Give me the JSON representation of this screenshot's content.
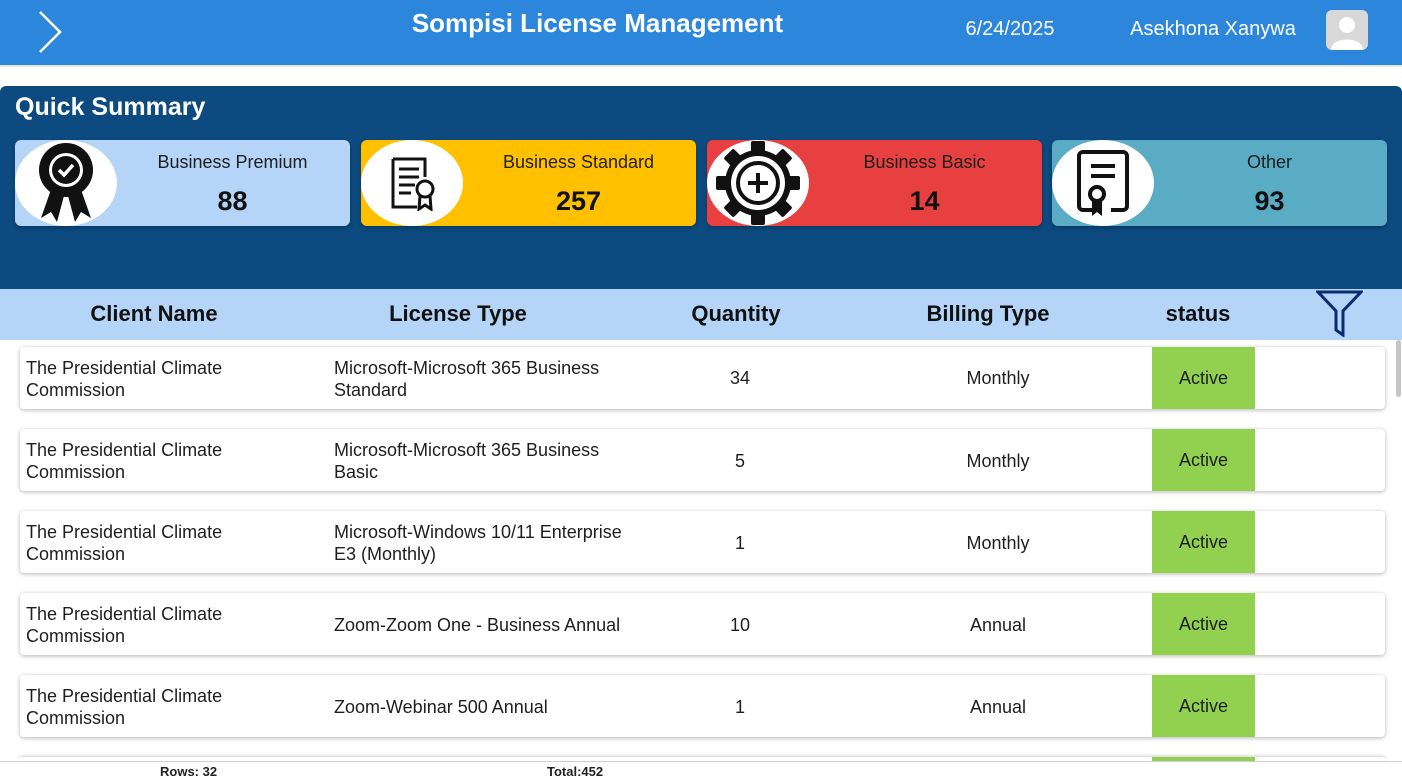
{
  "header": {
    "title": "Sompisi License Management",
    "date": "6/24/2025",
    "user_name": "Asekhona Xanywa"
  },
  "summary": {
    "title": "Quick Summary",
    "cards": [
      {
        "label": "Business Premium",
        "value": "88",
        "icon": "award-ribbon-icon",
        "color": "#b4d4f8"
      },
      {
        "label": "Business Standard",
        "value": "257",
        "icon": "certificate-document-icon",
        "color": "#ffc000"
      },
      {
        "label": "Business Basic",
        "value": "14",
        "icon": "gear-plus-icon",
        "color": "#e84040"
      },
      {
        "label": "Other",
        "value": "93",
        "icon": "license-document-icon",
        "color": "#5aacc4"
      }
    ]
  },
  "table": {
    "columns": [
      "Client Name",
      "License Type",
      "Quantity",
      "Billing Type",
      "status"
    ],
    "rows": [
      {
        "client": "The Presidential Climate Commission",
        "license": "Microsoft-Microsoft 365 Business Standard",
        "quantity": "34",
        "billing": "Monthly",
        "status": "Active"
      },
      {
        "client": "The Presidential Climate Commission",
        "license": "Microsoft-Microsoft 365 Business Basic",
        "quantity": "5",
        "billing": "Monthly",
        "status": "Active"
      },
      {
        "client": "The Presidential Climate Commission",
        "license": "Microsoft-Windows 10/11 Enterprise E3 (Monthly)",
        "quantity": "1",
        "billing": "Monthly",
        "status": "Active"
      },
      {
        "client": "The Presidential Climate Commission",
        "license": "Zoom-Zoom One - Business Annual",
        "quantity": "10",
        "billing": "Annual",
        "status": "Active"
      },
      {
        "client": "The Presidential Climate Commission",
        "license": "Zoom-Webinar 500 Annual",
        "quantity": "1",
        "billing": "Annual",
        "status": "Active"
      }
    ]
  },
  "footer": {
    "rows_text": "Rows: 32",
    "total_text": "Total:452"
  },
  "colors": {
    "topbar": "#2c86db",
    "summary_panel": "#0c4a80",
    "table_header": "#b4d4f8",
    "status_active": "#92d050"
  }
}
